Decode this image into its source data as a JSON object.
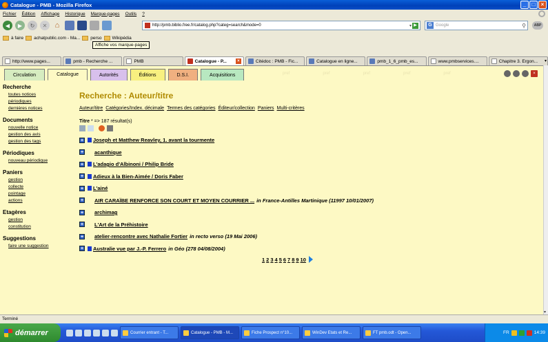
{
  "window": {
    "title": "Catalogue - PMB - Mozilla Firefox"
  },
  "menu": [
    "Fichier",
    "Édition",
    "Affichage",
    "Historique",
    "Marque-pages",
    "Outils",
    "?"
  ],
  "nav": {
    "url": "http://pmb.biblio.free.fr/catalog.php?categ=search&mode=0",
    "search_placeholder": "Google",
    "tooltip": "Affiche vos marque-pages",
    "abp": "ABP"
  },
  "bookmarks": [
    "à faire",
    "achatpublic.com - Ma...",
    "perso",
    "Wikipédia"
  ],
  "browser_tabs": [
    {
      "label": "http://www.pages...",
      "active": false
    },
    {
      "label": "pmb - Recherche ...",
      "active": false
    },
    {
      "label": "PMB",
      "active": false
    },
    {
      "label": "Catalogue - P...",
      "active": true
    },
    {
      "label": "Citédoc : PMB - Fic...",
      "active": false
    },
    {
      "label": "Catalogue en ligne...",
      "active": false
    },
    {
      "label": "pmb_1_6_pmb_es...",
      "active": false
    },
    {
      "label": "www.pmbservices....",
      "active": false
    },
    {
      "label": "Chapitre 3. Ergon...",
      "active": false
    }
  ],
  "pmb_tabs": [
    "Circulation",
    "Catalogue",
    "Autorités",
    "Éditions",
    "D.S.I.",
    "Acquisitions"
  ],
  "ghost_labels": [
    "pref",
    "pref",
    "pref",
    "pref",
    "pref"
  ],
  "sidebar": [
    {
      "heading": "Recherche",
      "links": [
        "toutes notices",
        "périodiques",
        "dernières notices"
      ]
    },
    {
      "heading": "Documents",
      "links": [
        "nouvelle notice",
        "gestion des avis",
        "gestion des tags"
      ]
    },
    {
      "heading": "Périodiques",
      "links": [
        "nouveau périodique"
      ]
    },
    {
      "heading": "Paniers",
      "links": [
        "gestion",
        "collecte",
        "pointage",
        "actions"
      ]
    },
    {
      "heading": "Etagères",
      "links": [
        "gestion",
        "constitution"
      ]
    },
    {
      "heading": "Suggestions",
      "links": [
        "faire une suggestion"
      ]
    }
  ],
  "main": {
    "page_title": "Recherche : Auteur/titre",
    "links": [
      "Auteur/titre",
      "Catégories/Index. décimale",
      "Termes des catégories",
      "Éditeur/collection",
      "Paniers",
      "Multi-critères"
    ],
    "title_label": "Titre",
    "title_query": "* => 187 résultat(s)",
    "results": [
      {
        "title": "Joseph et Matthew Reavley, 1. avant la tourmente",
        "square": true,
        "source": ""
      },
      {
        "title": "acanthique",
        "square": false,
        "source": ""
      },
      {
        "title": "L'adagio d'Albinoni / Philip Bride",
        "square": true,
        "source": ""
      },
      {
        "title": "Adieux à la Bien-Aimée / Doris Faber",
        "square": true,
        "source": ""
      },
      {
        "title": "L'ainé",
        "square": true,
        "source": ""
      },
      {
        "title": "AIR CARAÏBE RENFORCE SON COURT ET MOYEN COURRIER ...",
        "square": false,
        "source": "in France-Antilles Martinique (11997 10/01/2007)"
      },
      {
        "title": "archimag",
        "square": false,
        "source": ""
      },
      {
        "title": "L'Art de la Préhistoire",
        "square": false,
        "source": ""
      },
      {
        "title": "atelier-rencontre avec Nathalie Fortier",
        "square": false,
        "source": "in recto verso (19 Mai 2006)"
      },
      {
        "title": "Australie vue par J.-P. Ferrero",
        "square": true,
        "source": "in Géo (278 04/08/2004)"
      }
    ],
    "pages": [
      "1",
      "2",
      "3",
      "4",
      "5",
      "6",
      "7",
      "8",
      "9",
      "10"
    ]
  },
  "status": "Terminé",
  "taskbar": {
    "start": "démarrer",
    "tasks": [
      {
        "label": "Courrier entrant - T...",
        "active": false
      },
      {
        "label": "Catalogue - PMB - M...",
        "active": true
      },
      {
        "label": "Fiche Prospect n°10...",
        "active": false
      },
      {
        "label": "WinDev Etats et Re...",
        "active": false
      },
      {
        "label": "FT pmb.odt - Open...",
        "active": false
      }
    ],
    "lang": "FR",
    "clock": "14:39"
  }
}
